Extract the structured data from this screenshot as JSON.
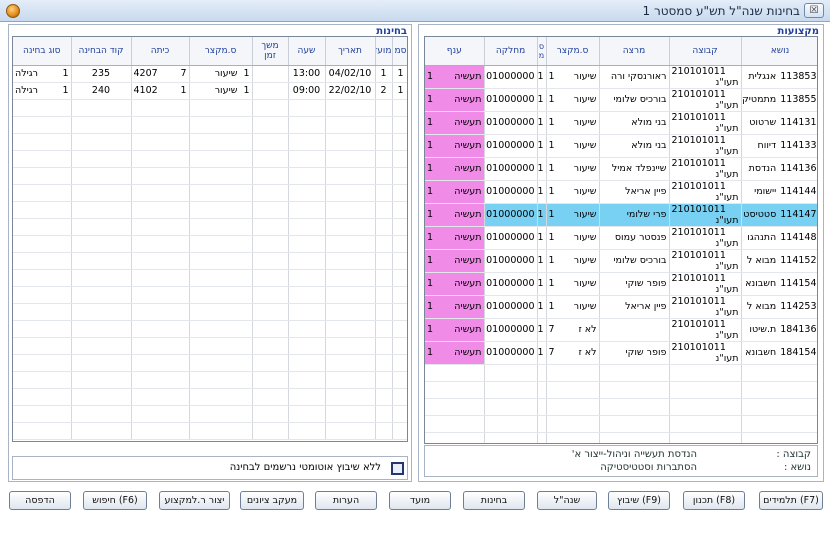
{
  "window": {
    "title": "בחינות שנה\"ל תש\"ע סמסטר 1",
    "close_label": "☒"
  },
  "groups": {
    "right_title": "מקצועות",
    "left_title": "בחינות"
  },
  "courses_table": {
    "headers": [
      "נושא",
      "קבוצה",
      "מרצה",
      "ס.מקצר",
      "ס\nמ",
      "מחלקה",
      "ענף"
    ],
    "rows": [
      {
        "num": "113853",
        "name": "אנגלית",
        "group": "210101011",
        "track": "תעו\"נ",
        "lecturer": "ראורנסקי ורה",
        "n1": "1",
        "type": "שיעור",
        "s": "1",
        "dept": "01000000",
        "b": "1",
        "branch": "תעשיה"
      },
      {
        "num": "113855",
        "name": "מתמטיק",
        "group": "210101011",
        "track": "תעו\"נ",
        "lecturer": "בורכיס שלומי",
        "n1": "1",
        "type": "שיעור",
        "s": "1",
        "dept": "01000000",
        "b": "1",
        "branch": "תעשיה"
      },
      {
        "num": "114131",
        "name": "שרטוט",
        "group": "210101011",
        "track": "תעו\"נ",
        "lecturer": "בני מולא",
        "n1": "1",
        "type": "שיעור",
        "s": "1",
        "dept": "01000000",
        "b": "1",
        "branch": "תעשיה"
      },
      {
        "num": "114133",
        "name": "דיווח",
        "group": "210101011",
        "track": "תעו\"נ",
        "lecturer": "בני מולא",
        "n1": "1",
        "type": "שיעור",
        "s": "1",
        "dept": "01000000",
        "b": "1",
        "branch": "תעשיה"
      },
      {
        "num": "114136",
        "name": "הנדסת",
        "group": "210101011",
        "track": "תעו\"נ",
        "lecturer": "שיינפלד אמיל",
        "n1": "1",
        "type": "שיעור",
        "s": "1",
        "dept": "01000000",
        "b": "1",
        "branch": "תעשיה"
      },
      {
        "num": "114144",
        "name": "יישומי",
        "group": "210101011",
        "track": "תעו\"נ",
        "lecturer": "פיין אריאל",
        "n1": "1",
        "type": "שיעור",
        "s": "1",
        "dept": "01000000",
        "b": "1",
        "branch": "תעשיה"
      },
      {
        "num": "114147",
        "name": "סטטיסט",
        "group": "210101011",
        "track": "תעו\"נ",
        "lecturer": "פרי שלומי",
        "n1": "1",
        "type": "שיעור",
        "s": "1",
        "dept": "01000000",
        "b": "1",
        "branch": "תעשיה",
        "selected": true
      },
      {
        "num": "114148",
        "name": "התנהגו",
        "group": "210101011",
        "track": "תעו\"נ",
        "lecturer": "פנסטר עמוס",
        "n1": "1",
        "type": "שיעור",
        "s": "1",
        "dept": "01000000",
        "b": "1",
        "branch": "תעשיה"
      },
      {
        "num": "114152",
        "name": "מבוא ל",
        "group": "210101011",
        "track": "תעו\"נ",
        "lecturer": "בורכיס שלומי",
        "n1": "1",
        "type": "שיעור",
        "s": "1",
        "dept": "01000000",
        "b": "1",
        "branch": "תעשיה"
      },
      {
        "num": "114154",
        "name": "חשבונא",
        "group": "210101011",
        "track": "תעו\"נ",
        "lecturer": "פופר שוקי",
        "n1": "1",
        "type": "שיעור",
        "s": "1",
        "dept": "01000000",
        "b": "1",
        "branch": "תעשיה"
      },
      {
        "num": "114253",
        "name": "מבוא ל",
        "group": "210101011",
        "track": "תעו\"נ",
        "lecturer": "פיין אריאל",
        "n1": "1",
        "type": "שיעור",
        "s": "1",
        "dept": "01000000",
        "b": "1",
        "branch": "תעשיה"
      },
      {
        "num": "184136",
        "name": "ת.שיטו",
        "group": "210101011",
        "track": "תעו\"נ",
        "lecturer": "",
        "n1": "7",
        "type": "לא ז",
        "s": "1",
        "dept": "01000000",
        "b": "1",
        "branch": "תעשיה"
      },
      {
        "num": "184154",
        "name": "חשבונא",
        "group": "210101011",
        "track": "תעו\"נ",
        "lecturer": "פופר שוקי",
        "n1": "7",
        "type": "לא ז",
        "s": "1",
        "dept": "01000000",
        "b": "1",
        "branch": "תעשיה"
      }
    ]
  },
  "exams_table": {
    "headers": [
      "סמ",
      "מועד",
      "תאריך",
      "שעה",
      "משך\nזמן",
      "ס.מקצר",
      "כיתה",
      "קוד הבחינה",
      "סוג בחינה"
    ],
    "rows": [
      {
        "sem": "1",
        "moed": "1",
        "date": "04/02/10",
        "time": "13:00",
        "dur": "",
        "n": "1",
        "type": "שיעור",
        "room_a": "7",
        "room_b": "4207",
        "code": "235",
        "kind_n": "1",
        "kind": "רגילה"
      },
      {
        "sem": "1",
        "moed": "2",
        "date": "22/02/10",
        "time": "09:00",
        "dur": "",
        "n": "1",
        "type": "שיעור",
        "room_a": "1",
        "room_b": "4102",
        "code": "240",
        "kind_n": "1",
        "kind": "רגילה"
      }
    ]
  },
  "info": {
    "group_label": "קבוצה :",
    "group_value": "הנדסת תעשייה וניהול-ייצור א'",
    "subject_label": "נושא :",
    "subject_value": "הסתברות וסטטיסטיקה"
  },
  "checkbox": {
    "label": "ללא שיבוץ אוטומטי נרשמים לבחינה",
    "checked": false
  },
  "buttons": {
    "students": "תלמידים (F7)",
    "planning": "תכנון (F8)",
    "assign": "שיבוץ (F9)",
    "year": "שנה\"ל",
    "exams": "בחינות",
    "moed": "מועד",
    "notes": "הערות",
    "grades": "מעקב ציונים",
    "create": "יצור ר.למקצוע",
    "search": "חיפוש (F6)",
    "print": "הדפסה"
  },
  "colors": {
    "selected_row": "#78d0f2",
    "branch_cell": "#f08ce8",
    "header_text": "#1f3f9a"
  }
}
